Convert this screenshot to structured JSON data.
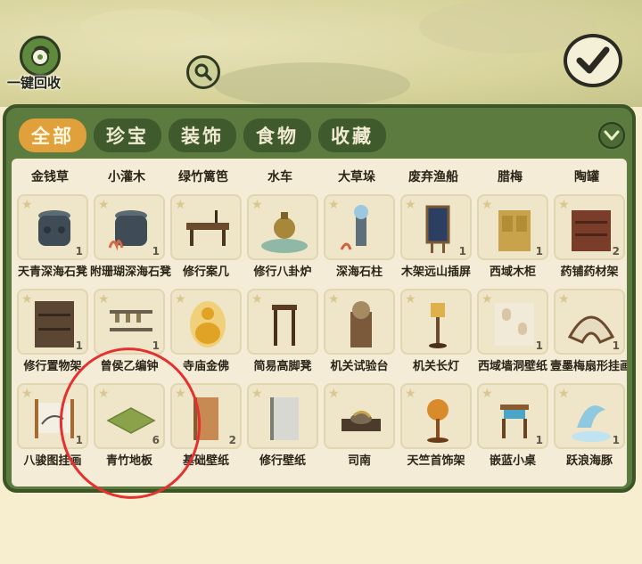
{
  "header": {
    "recycle_label": "一键回收"
  },
  "icons": {
    "recycle": "recycle-icon",
    "search": "search-icon",
    "confirm": "check-icon",
    "collapse": "chevron-down-icon"
  },
  "tabs": [
    {
      "label": "全部",
      "active": true
    },
    {
      "label": "珍宝",
      "active": false
    },
    {
      "label": "装饰",
      "active": false
    },
    {
      "label": "食物",
      "active": false
    },
    {
      "label": "收藏",
      "active": false
    }
  ],
  "partial_row": [
    "金钱草",
    "小灌木",
    "绿竹篱笆",
    "水车",
    "大草垛",
    "废弃渔船",
    "腊梅",
    "陶罐"
  ],
  "items": [
    {
      "label": "天青深海石凳",
      "count": "1",
      "art": "stool-dark"
    },
    {
      "label": "附珊瑚深海石凳",
      "count": "1",
      "art": "stool-coral"
    },
    {
      "label": "修行案几",
      "count": "",
      "art": "desk"
    },
    {
      "label": "修行八卦炉",
      "count": "",
      "art": "furnace"
    },
    {
      "label": "深海石柱",
      "count": "",
      "art": "pillar-blue"
    },
    {
      "label": "木架远山插屏",
      "count": "1",
      "art": "screen"
    },
    {
      "label": "西域木柜",
      "count": "1",
      "art": "cabinet"
    },
    {
      "label": "药铺药材架",
      "count": "2",
      "art": "shelf"
    },
    {
      "label": "修行置物架",
      "count": "1",
      "art": "shelf-dark"
    },
    {
      "label": "曾侯乙编钟",
      "count": "1",
      "art": "bells"
    },
    {
      "label": "寺庙金佛",
      "count": "",
      "art": "buddha"
    },
    {
      "label": "简易高脚凳",
      "count": "",
      "art": "high-stool"
    },
    {
      "label": "机关试验台",
      "count": "",
      "art": "machine"
    },
    {
      "label": "机关长灯",
      "count": "",
      "art": "lamp"
    },
    {
      "label": "西域墙洞壁纸",
      "count": "1",
      "art": "wall-niche"
    },
    {
      "label": "壹墨梅扇形挂画",
      "count": "1",
      "art": "fan-painting"
    },
    {
      "label": "八骏图挂画",
      "count": "1",
      "art": "scroll"
    },
    {
      "label": "青竹地板",
      "count": "6",
      "art": "floor"
    },
    {
      "label": "基础壁纸",
      "count": "2",
      "art": "wallpaper-basic"
    },
    {
      "label": "修行壁纸",
      "count": "",
      "art": "wallpaper-grey"
    },
    {
      "label": "司南",
      "count": "",
      "art": "compass"
    },
    {
      "label": "天竺首饰架",
      "count": "",
      "art": "jewelry-stand"
    },
    {
      "label": "嵌蓝小桌",
      "count": "1",
      "art": "small-table"
    },
    {
      "label": "跃浪海豚",
      "count": "1",
      "art": "dolphin"
    }
  ]
}
